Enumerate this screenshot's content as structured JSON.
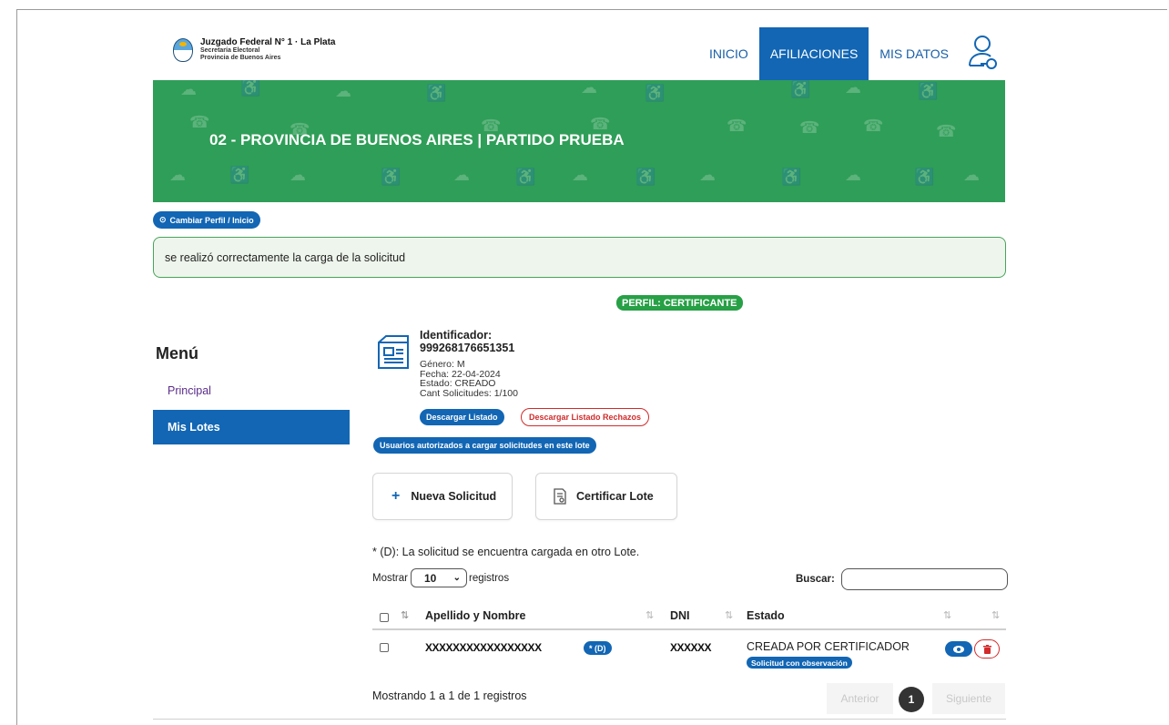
{
  "header": {
    "brand_title": "Juzgado Federal N° 1 · La Plata",
    "brand_line1": "Secretaría Electoral",
    "brand_line2": "Provincia de Buenos Aires",
    "nav": [
      {
        "label": "INICIO",
        "active": false
      },
      {
        "label": "AFILIACIONES",
        "active": true
      },
      {
        "label": "MIS DATOS",
        "active": false
      }
    ]
  },
  "banner": {
    "title": "02 - PROVINCIA DE BUENOS AIRES | PARTIDO PRUEBA",
    "color": "#2f9e58"
  },
  "actions": {
    "change_profile": "Cambiar Perfil / Inicio"
  },
  "alert": {
    "message": "se realizó correctamente la carga de la solicitud"
  },
  "profile_badge": "PERFIL: CERTIFICANTE",
  "sidebar": {
    "title": "Menú",
    "items": [
      {
        "label": "Principal",
        "active": false
      },
      {
        "label": "Mis Lotes",
        "active": true
      }
    ]
  },
  "lot": {
    "id_label": "Identificador:",
    "id_value": "999268176651351",
    "genero": "Género: M",
    "fecha": "Fecha: 22-04-2024",
    "estado": "Estado: CREADO",
    "cant": "Cant Solicitudes: 1/100",
    "btn_download": "Descargar Listado",
    "btn_download_rejected": "Descargar Listado Rechazos",
    "btn_authorized": "Usuarios autorizados a cargar solicitudes en este lote"
  },
  "cards": {
    "new_request": "Nueva Solicitud",
    "certify_lot": "Certificar Lote"
  },
  "note": "* (D): La solicitud se encuentra cargada en otro Lote.",
  "table_controls": {
    "show_label": "Mostrar",
    "show_value": "10",
    "records_label": "registros",
    "search_label": "Buscar:",
    "search_value": ""
  },
  "table": {
    "columns": [
      "Apellido y Nombre",
      "DNI",
      "Estado"
    ],
    "rows": [
      {
        "name": "XXXXXXXXXXXXXXXXX",
        "duplicate_badge": "* (D)",
        "dni": "XXXXXX",
        "estado": "CREADA POR CERTIFICADOR",
        "observation": "Solicitud con observación"
      }
    ]
  },
  "pagination": {
    "info": "Mostrando 1 a 1 de 1 registros",
    "prev": "Anterior",
    "current": "1",
    "next": "Siguiente"
  },
  "colors": {
    "primary": "#1266b4",
    "success": "#27a046",
    "danger": "#d12b2b"
  }
}
